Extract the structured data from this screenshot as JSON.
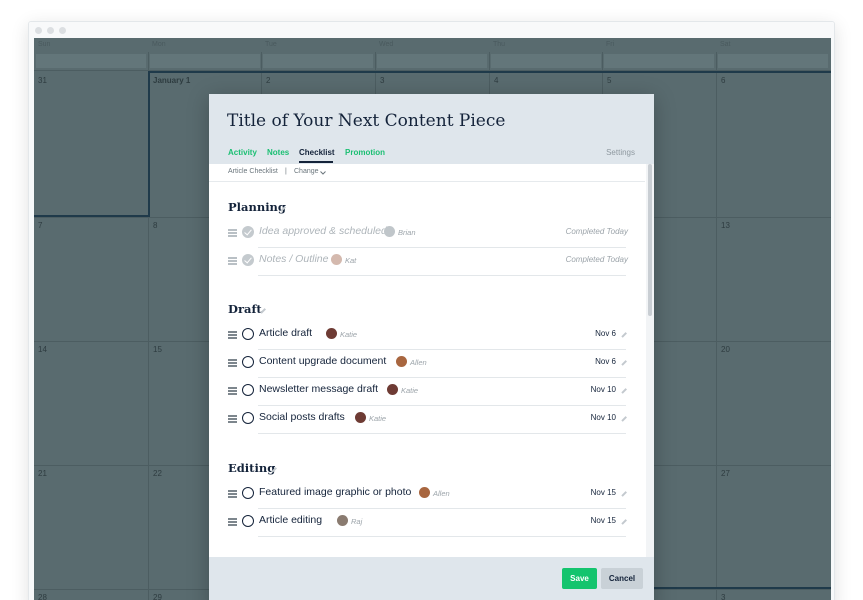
{
  "calendar": {
    "days": [
      "Sun",
      "Mon",
      "Tue",
      "Wed",
      "Thu",
      "Fri",
      "Sat"
    ],
    "dates": [
      "31",
      "January 1",
      "2",
      "3",
      "4",
      "5",
      "6",
      "7",
      "8",
      "13",
      "14",
      "15",
      "20",
      "21",
      "22",
      "27",
      "28",
      "29",
      "3"
    ]
  },
  "modal": {
    "title": "Title of Your Next Content Piece",
    "tabs": [
      "Activity",
      "Notes",
      "Checklist",
      "Promotion"
    ],
    "active_tab": "Checklist",
    "settings": "Settings",
    "checklist_name": "Article Checklist",
    "separator": "|",
    "change": "Change",
    "sections": [
      {
        "title": "Planning",
        "items": [
          {
            "label": "Idea approved & scheduled",
            "assignee": "Brian",
            "due": "Completed Today",
            "done": true,
            "avatar_color": "#c0c6ca"
          },
          {
            "label": "Notes / Outline",
            "assignee": "Kat",
            "due": "Completed Today",
            "done": true,
            "avatar_color": "#d4b9ae"
          }
        ]
      },
      {
        "title": "Draft",
        "items": [
          {
            "label": "Article draft",
            "assignee": "Katie",
            "due": "Nov 6",
            "done": false,
            "avatar_color": "#6e3b34"
          },
          {
            "label": "Content upgrade document",
            "assignee": "Allen",
            "due": "Nov 6",
            "done": false,
            "avatar_color": "#a8663f"
          },
          {
            "label": "Newsletter message draft",
            "assignee": "Katie",
            "due": "Nov 10",
            "done": false,
            "avatar_color": "#6e3b34"
          },
          {
            "label": "Social posts drafts",
            "assignee": "Katie",
            "due": "Nov 10",
            "done": false,
            "avatar_color": "#6e3b34"
          }
        ]
      },
      {
        "title": "Editing",
        "items": [
          {
            "label": "Featured image graphic or photo",
            "assignee": "Allen",
            "due": "Nov 15",
            "done": false,
            "avatar_color": "#a8663f"
          },
          {
            "label": "Article editing",
            "assignee": "Raj",
            "due": "Nov 15",
            "done": false,
            "avatar_color": "#8a7b70"
          }
        ]
      }
    ],
    "buttons": {
      "save": "Save",
      "cancel": "Cancel"
    }
  },
  "colors": {
    "accent": "#14c46e",
    "text_dark": "#14233a",
    "calendar_bg": "#596b6f"
  }
}
